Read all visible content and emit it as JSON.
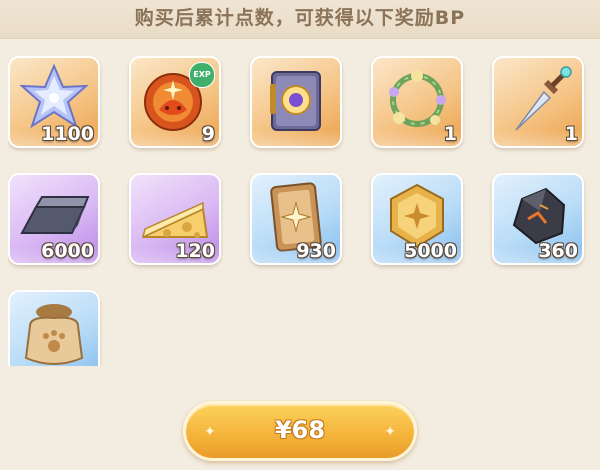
{
  "header": {
    "title": "购买后累计点数，可获得以下奖励BP"
  },
  "rewards": [
    {
      "name": "crystal-star",
      "quantity": "1100",
      "rarity": "orange"
    },
    {
      "name": "exp-slime",
      "quantity": "9",
      "rarity": "orange",
      "badge": "EXP"
    },
    {
      "name": "magic-book",
      "quantity": "",
      "rarity": "orange"
    },
    {
      "name": "flower-wreath",
      "quantity": "1",
      "rarity": "orange"
    },
    {
      "name": "crystal-dagger",
      "quantity": "1",
      "rarity": "orange"
    },
    {
      "name": "iron-ingot",
      "quantity": "6000",
      "rarity": "purple"
    },
    {
      "name": "cheese",
      "quantity": "120",
      "rarity": "purple"
    },
    {
      "name": "star-card",
      "quantity": "930",
      "rarity": "blue"
    },
    {
      "name": "gold-coin",
      "quantity": "5000",
      "rarity": "blue"
    },
    {
      "name": "dark-ore",
      "quantity": "360",
      "rarity": "blue"
    },
    {
      "name": "paw-sack",
      "quantity": "",
      "rarity": "blue"
    }
  ],
  "purchase": {
    "price_label": "¥68"
  },
  "colors": {
    "background": "#f3ece0",
    "header_text": "#8a7358",
    "button": "#f4b23a"
  }
}
